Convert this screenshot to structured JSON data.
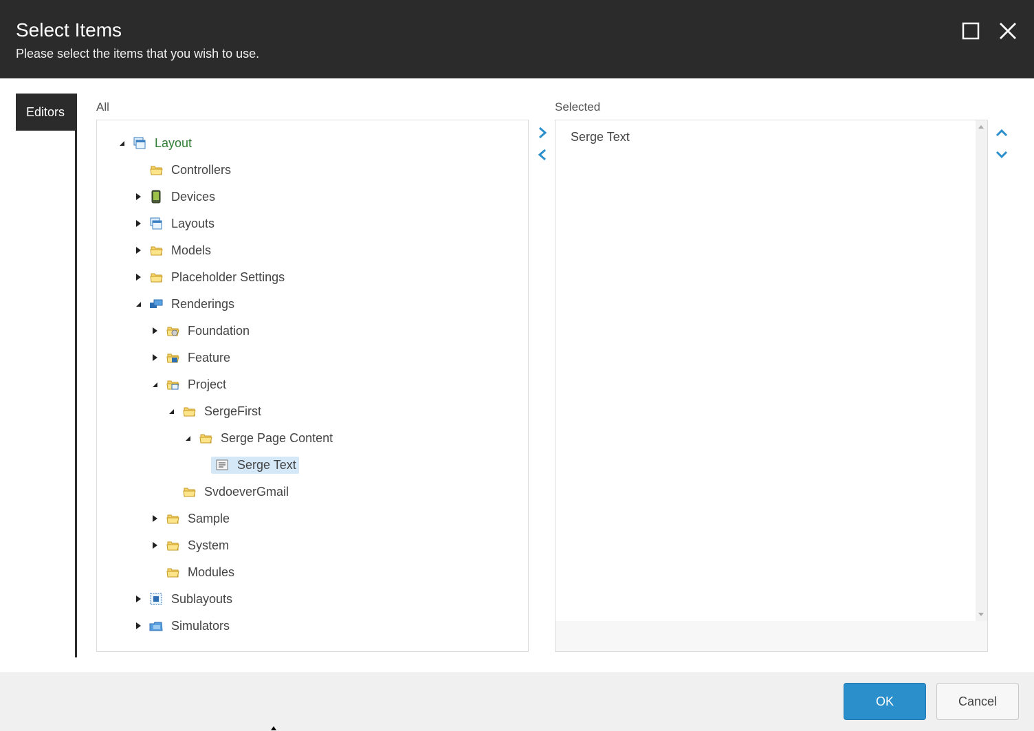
{
  "dialog": {
    "title": "Select Items",
    "subtitle": "Please select the items that you wish to use.",
    "maximize_icon": "maximize-icon",
    "close_icon": "close-icon"
  },
  "tabs": [
    {
      "label": "Editors",
      "active": true
    }
  ],
  "panels": {
    "all_label": "All",
    "selected_label": "Selected"
  },
  "tree": [
    {
      "label": "Layout",
      "depth": 0,
      "toggle": "expanded",
      "icon": "layout-icon",
      "root": true
    },
    {
      "label": "Controllers",
      "depth": 1,
      "toggle": "none",
      "icon": "folder-icon"
    },
    {
      "label": "Devices",
      "depth": 1,
      "toggle": "collapsed",
      "icon": "device-icon"
    },
    {
      "label": "Layouts",
      "depth": 1,
      "toggle": "collapsed",
      "icon": "layout-icon"
    },
    {
      "label": "Models",
      "depth": 1,
      "toggle": "collapsed",
      "icon": "folder-icon"
    },
    {
      "label": "Placeholder Settings",
      "depth": 1,
      "toggle": "collapsed",
      "icon": "folder-icon"
    },
    {
      "label": "Renderings",
      "depth": 1,
      "toggle": "expanded",
      "icon": "renderings-icon"
    },
    {
      "label": "Foundation",
      "depth": 2,
      "toggle": "collapsed",
      "icon": "foundation-folder-icon"
    },
    {
      "label": "Feature",
      "depth": 2,
      "toggle": "collapsed",
      "icon": "feature-folder-icon"
    },
    {
      "label": "Project",
      "depth": 2,
      "toggle": "expanded",
      "icon": "project-folder-icon"
    },
    {
      "label": "SergeFirst",
      "depth": 3,
      "toggle": "expanded",
      "icon": "folder-icon"
    },
    {
      "label": "Serge Page Content",
      "depth": 4,
      "toggle": "expanded",
      "icon": "folder-icon"
    },
    {
      "label": "Serge Text",
      "depth": 5,
      "toggle": "none",
      "icon": "rendering-item-icon",
      "selected": true
    },
    {
      "label": "SvdoeverGmail",
      "depth": 3,
      "toggle": "none",
      "icon": "folder-icon"
    },
    {
      "label": "Sample",
      "depth": 2,
      "toggle": "collapsed",
      "icon": "folder-icon"
    },
    {
      "label": "System",
      "depth": 2,
      "toggle": "collapsed",
      "icon": "folder-icon"
    },
    {
      "label": "Modules",
      "depth": 2,
      "toggle": "none",
      "icon": "folder-icon"
    },
    {
      "label": "Sublayouts",
      "depth": 1,
      "toggle": "collapsed",
      "icon": "sublayout-icon"
    },
    {
      "label": "Simulators",
      "depth": 1,
      "toggle": "collapsed",
      "icon": "simulators-icon"
    }
  ],
  "selected_items": [
    "Serge Text"
  ],
  "footer": {
    "ok_label": "OK",
    "cancel_label": "Cancel"
  },
  "colors": {
    "header_bg": "#2b2b2b",
    "accent_blue": "#2b8fcc",
    "selection": "#d5e8f7",
    "root_label": "#2e7d32"
  }
}
